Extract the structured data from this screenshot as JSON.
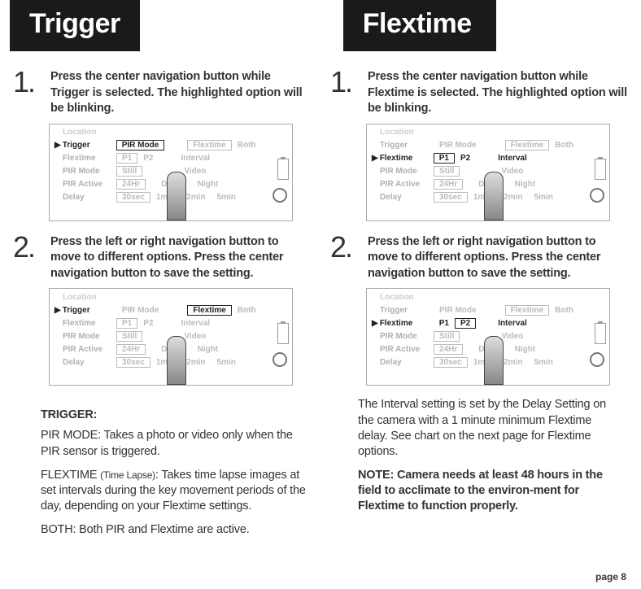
{
  "header": {
    "left": "Trigger",
    "right": "Flextime"
  },
  "left": {
    "step1": {
      "num": "1.",
      "text": "Press the center navigation button while Trigger is selected. The highlighted option will be blinking."
    },
    "step2": {
      "num": "2.",
      "text": "Press the left or right navigation button to move to different options. Press the center navigation button to save the setting."
    },
    "heading": "TRIGGER:",
    "p1_bold": "PIR MODE:",
    "p1_rest": " Takes a photo or video only when the PIR sensor is triggered.",
    "p2_bold": "FLEXTIME ",
    "p2_small": "(Time Lapse)",
    "p2_rest": ": Takes time lapse images at set intervals during the key movement periods of the day, depending on your Flextime settings.",
    "p3_bold": "BOTH:",
    "p3_rest": " Both PIR and Flextime are active."
  },
  "right": {
    "step1": {
      "num": "1.",
      "text": "Press the center navigation button while Flextime is selected. The highlighted option will be blinking."
    },
    "step2": {
      "num": "2.",
      "text": "Press the left or right navigation button to move to different options. Press the center navigation button to save the setting."
    },
    "p1": "The Interval setting is set by the Delay Setting on the camera with a 1 minute minimum Flextime delay. See chart on the next page for Flextime options.",
    "p2_bold": "NOTE:",
    "p2_rest": " Camera needs at least 48 hours in the field to acclimate to the environ-ment for Flextime to function properly."
  },
  "menu": {
    "location": "Location",
    "trigger": "Trigger",
    "flextime": "Flextime",
    "pirmode": "PIR Mode",
    "piractive": "PIR Active",
    "delay": "Delay",
    "pirmode_label": "PIR Mode",
    "flextime_label": "Flextime",
    "both": "Both",
    "p1": "P1",
    "p2": "P2",
    "interval": "Interval",
    "still": "Still",
    "video": "Video",
    "h24": "24Hr",
    "day": "Day",
    "night": "Night",
    "s30": "30sec",
    "m1": "1min",
    "m2": "2min",
    "m5": "5min"
  },
  "page": "page 8"
}
